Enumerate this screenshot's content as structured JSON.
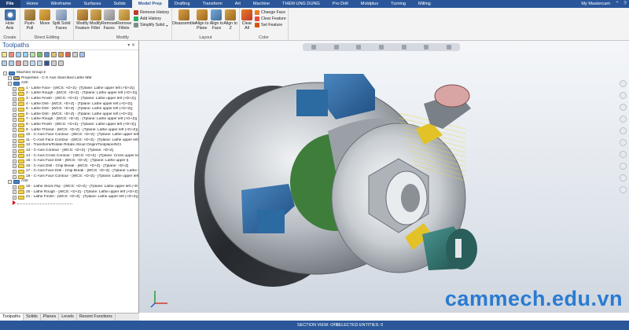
{
  "tabs": [
    "File",
    "Home",
    "Wireframe",
    "Surfaces",
    "Solids",
    "Model Prep",
    "Drafting",
    "Transform",
    "Art",
    "Machine",
    "THEM UNG DUNG",
    "Pro Drill",
    "Moldplus",
    "Turning",
    "Milling"
  ],
  "active_tab": "Model Prep",
  "account": "My Mastercam",
  "ribbon": {
    "create": {
      "label": "Create",
      "hole_axis": "Hole Axis"
    },
    "direct_editing": {
      "label": "Direct Editing",
      "push_pull": "Push-Pull",
      "move": "Move",
      "split_solid_faces": "Split Solid Faces"
    },
    "modify": {
      "label": "Modify",
      "modify_feature": "Modify Feature",
      "modify_fillet": "Modify Fillet",
      "remove_faces": "Remove Faces",
      "remove_fillets": "Remove Fillets",
      "remove_history": "Remove History",
      "add_history": "Add History",
      "simplify_solid": "Simplify Solid"
    },
    "layout": {
      "label": "Layout",
      "disassemble": "Disassemble",
      "align_to_plane": "Align to Plane",
      "align_to_face": "Align to Face",
      "align_to_z": "Align to Z"
    },
    "color": {
      "label": "Color",
      "clear_all": "Clear All",
      "change_face": "Change Face",
      "clear_feature": "Clear Feature",
      "set_feature": "Set Feature"
    }
  },
  "panel": {
    "title": "Toolpaths"
  },
  "tree": [
    {
      "text": "Machine Group-2",
      "indent": 0,
      "icon": "machine"
    },
    {
      "text": "Properties - C-X Axis Slant Bed Lathe MM",
      "indent": 1,
      "icon": "props"
    },
    {
      "text": "A20",
      "indent": 1,
      "icon": "group"
    },
    {
      "text": "1 - Lathe Face - [WCS: +D+Z] - [Tplane: Lathe upper left (+D+Z)]",
      "indent": 2,
      "icon": "op"
    },
    {
      "text": "2 - Lathe Rough - [WCS: +D+Z] - [Tplane: Lathe upper left (+D+Z)]",
      "indent": 2,
      "icon": "op"
    },
    {
      "text": "3 - Lathe Finish - [WCS: +D+Z] - [Tplane: Lathe upper left (+D+Z)]",
      "indent": 2,
      "icon": "op"
    },
    {
      "text": "4 - Lathe Drill - [WCS: +D+Z] - [Tplane: Lathe upper left (+D+Z)]",
      "indent": 2,
      "icon": "op"
    },
    {
      "text": "5 - Lathe Drill - [WCS: +D+Z] - [Tplane: Lathe upper left (+D+Z)]",
      "indent": 2,
      "icon": "op"
    },
    {
      "text": "6 - Lathe Drill - [WCS: +D+Z] - [Tplane: Lathe upper left (+D+Z)]",
      "indent": 2,
      "icon": "op"
    },
    {
      "text": "7 - Lathe Rough - [WCS: +D+Z] - [Tplane: Lathe upper left (+D+Z)]",
      "indent": 2,
      "icon": "op"
    },
    {
      "text": "8 - Lathe Finish - [WCS: +D+Z] - [Tplane: Lathe upper left (+D+Z)]",
      "indent": 2,
      "icon": "op"
    },
    {
      "text": "9 - Lathe Thread - [WCS: +D+Z] - [Tplane: Lathe upper left (+D+Z)]",
      "indent": 2,
      "icon": "op"
    },
    {
      "text": "10 - C-Axis Face Contour - [WCS: +D+Z] - [Tplane: Lathe upper left]",
      "indent": 2,
      "icon": "op"
    },
    {
      "text": "11 - C-Axis Face Contour - [WCS: +D+Z] - [Tplane: Lathe upper left]",
      "indent": 2,
      "icon": "op"
    },
    {
      "text": "12 - Transform/Rotate Rotate About Origin/Toolplane/NCI",
      "indent": 2,
      "icon": "op"
    },
    {
      "text": "13 - C-Axis Contour - [WCS: +D+Z] - [Tplane: +D+Z]",
      "indent": 2,
      "icon": "op"
    },
    {
      "text": "14 - C-Axis Cross Contour - [WCS: +D+Z] - [Tplane: Cross upper left]",
      "indent": 2,
      "icon": "op"
    },
    {
      "text": "15 - C-Axis Face Drill - [WCS: +D+Z] - [Tplane: Lathe upper l]",
      "indent": 2,
      "icon": "op"
    },
    {
      "text": "16 - C-Axis Drill - Chip Break - [WCS: +D+Z] - [Tplane: +D+Z]",
      "indent": 2,
      "icon": "op"
    },
    {
      "text": "17 - C-Axis Face Drill - Chip Break - [WCS: +D+Z] - [Tplane: Lathe up]",
      "indent": 2,
      "icon": "op"
    },
    {
      "text": "18 - C-Axis Face Contour - [WCS: +D+Z] - [Tplane: Lathe upper left]",
      "indent": 2,
      "icon": "op"
    },
    {
      "text": "A30",
      "indent": 1,
      "icon": "group"
    },
    {
      "text": "19 - Lathe Stock Flip - [WCS: +D+Z] - [Tplane: Lathe upper left (+D+Z)]",
      "indent": 2,
      "icon": "op"
    },
    {
      "text": "20 - Lathe Rough - [WCS: +D+Z] - [Tplane: Lathe upper left (+D+Z)]",
      "indent": 2,
      "icon": "op"
    },
    {
      "text": "21 - Lathe Finish - [WCS: +D+Z] - [Tplane: Lathe upper left (+D+Z)]",
      "indent": 2,
      "icon": "op"
    },
    {
      "text": "",
      "indent": 2,
      "icon": "insert-arrow"
    }
  ],
  "bottom_tabs": [
    "Toolpaths",
    "Solids",
    "Planes",
    "Levels",
    "Recent Functions"
  ],
  "status": {
    "section_view": "SECTION VIEW: OFF",
    "selected_entities": "SELECTED ENTITIES: 0"
  },
  "watermark": "cammech.edu.vn",
  "colors": {
    "accent": "#2b579a",
    "watermark": "#2a7bd1",
    "clamp_blue": "#2a5f93",
    "tool_green": "#2f6e6a",
    "op_yellow": "#f2d34a"
  }
}
